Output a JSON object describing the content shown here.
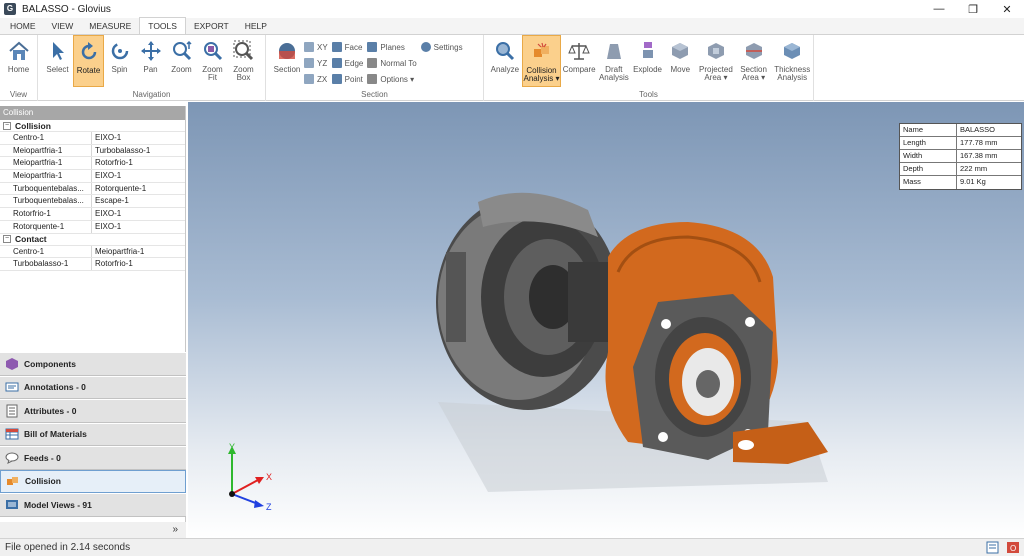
{
  "window": {
    "title": "BALASSO - Glovius",
    "app_icon_letter": "G",
    "minimize": "—",
    "restore": "❐",
    "close": "✕"
  },
  "menu": {
    "tabs": [
      {
        "label": "HOME"
      },
      {
        "label": "VIEW"
      },
      {
        "label": "MEASURE"
      },
      {
        "label": "TOOLS",
        "active": true
      },
      {
        "label": "EXPORT"
      },
      {
        "label": "HELP"
      }
    ]
  },
  "ribbon": {
    "view_group": {
      "label": "View",
      "home": "Home"
    },
    "navigation_group": {
      "label": "Navigation",
      "select": "Select",
      "rotate": "Rotate",
      "spin": "Spin",
      "pan": "Pan",
      "zoom": "Zoom",
      "zoom_fit_1": "Zoom",
      "zoom_fit_2": "Fit",
      "zoom_box_1": "Zoom",
      "zoom_box_2": "Box"
    },
    "section_group": {
      "label": "Section",
      "section": "Section",
      "xy": "XY",
      "yz": "YZ",
      "zx": "ZX",
      "face": "Face",
      "edge": "Edge",
      "point": "Point",
      "planes": "Planes",
      "normal_to": "Normal To",
      "options": "Options ▾",
      "settings": "Settings"
    },
    "tools_group": {
      "label": "Tools",
      "analyze": "Analyze",
      "collision_1": "Collision",
      "collision_2": "Analysis ▾",
      "compare": "Compare",
      "draft_1": "Draft",
      "draft_2": "Analysis",
      "explode": "Explode",
      "move": "Move",
      "projected_1": "Projected",
      "projected_2": "Area ▾",
      "section_area_1": "Section",
      "section_area_2": "Area ▾",
      "thickness_1": "Thickness",
      "thickness_2": "Analysis"
    }
  },
  "left_panel": {
    "header": "Collision",
    "collision_label": "Collision",
    "contact_label": "Contact",
    "collision_rows": [
      {
        "a": "Centro-1",
        "b": "EIXO-1"
      },
      {
        "a": "Meiopartfria-1",
        "b": "Turbobalasso-1"
      },
      {
        "a": "Meiopartfria-1",
        "b": "Rotorfrio-1"
      },
      {
        "a": "Meiopartfria-1",
        "b": "EIXO-1"
      },
      {
        "a": "Turboquentebalas...",
        "b": "Rotorquente-1"
      },
      {
        "a": "Turboquentebalas...",
        "b": "Escape-1"
      },
      {
        "a": "Rotorfrio-1",
        "b": "EIXO-1"
      },
      {
        "a": "Rotorquente-1",
        "b": "EIXO-1"
      }
    ],
    "contact_rows": [
      {
        "a": "Centro-1",
        "b": "Meiopartfria-1"
      },
      {
        "a": "Turbobalasso-1",
        "b": "Rotorfrio-1"
      }
    ],
    "tabs": [
      {
        "label": "Components"
      },
      {
        "label": "Annotations - 0"
      },
      {
        "label": "Attributes - 0"
      },
      {
        "label": "Bill of Materials"
      },
      {
        "label": "Feeds - 0"
      },
      {
        "label": "Collision"
      },
      {
        "label": "Model Views - 91"
      }
    ],
    "footer_chevron": "»"
  },
  "properties": {
    "rows": [
      {
        "k": "Name",
        "v": "BALASSO"
      },
      {
        "k": "Length",
        "v": "177.78 mm"
      },
      {
        "k": "Width",
        "v": "167.38 mm"
      },
      {
        "k": "Depth",
        "v": "222 mm"
      },
      {
        "k": "Mass",
        "v": "9.01 Kg"
      }
    ]
  },
  "triad": {
    "x": "X",
    "y": "Y",
    "z": "Z"
  },
  "status": {
    "text": "File opened in 2.14 seconds"
  },
  "colors": {
    "accent": "#fbd08c",
    "model_orange": "#d2691e",
    "model_gray": "#6e6e6e"
  }
}
